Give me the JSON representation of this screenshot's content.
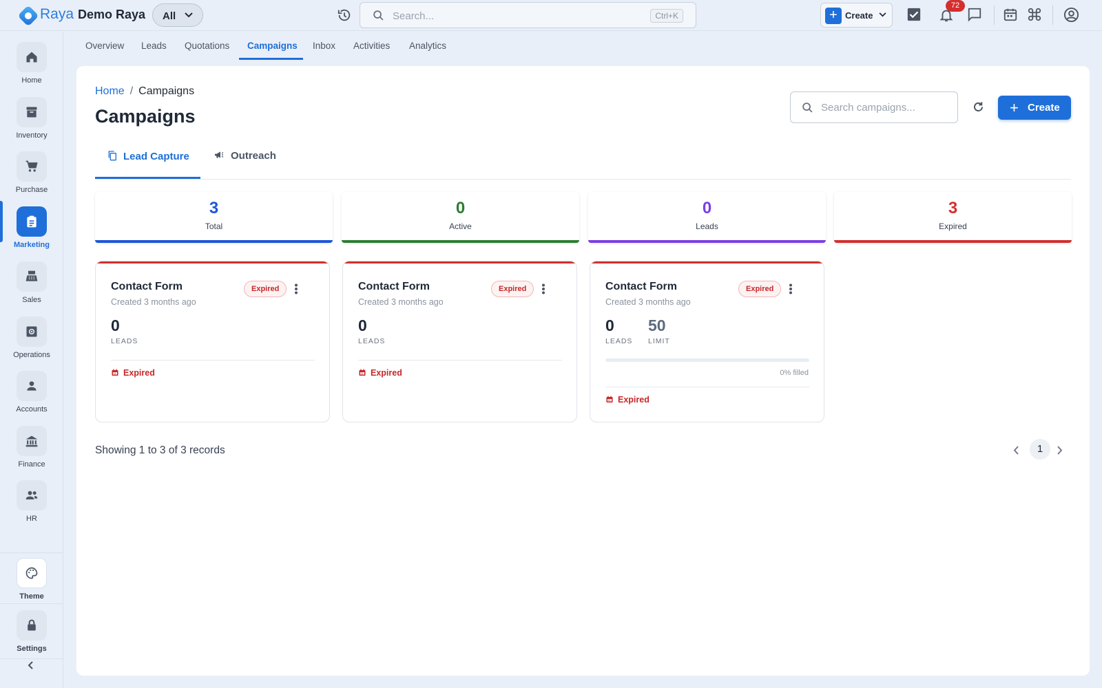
{
  "app": {
    "brand": "Raya",
    "org": "Demo Raya",
    "scope": "All",
    "search_placeholder": "Search...",
    "search_shortcut": "Ctrl+K",
    "create_label": "Create",
    "notification_count": "72"
  },
  "sidebar": {
    "items": [
      {
        "label": "Home",
        "icon": "home-icon"
      },
      {
        "label": "Inventory",
        "icon": "archive-icon"
      },
      {
        "label": "Purchase",
        "icon": "cart-icon"
      },
      {
        "label": "Marketing",
        "icon": "clipboard-icon",
        "active": true
      },
      {
        "label": "Sales",
        "icon": "register-icon"
      },
      {
        "label": "Operations",
        "icon": "cog-box-icon"
      },
      {
        "label": "Accounts",
        "icon": "person-icon"
      },
      {
        "label": "Finance",
        "icon": "bank-icon"
      },
      {
        "label": "HR",
        "icon": "people-icon"
      }
    ],
    "theme_label": "Theme",
    "settings_label": "Settings"
  },
  "subnav": {
    "tabs": [
      "Overview",
      "Leads",
      "Quotations",
      "Campaigns",
      "Inbox",
      "Activities",
      "Analytics"
    ],
    "active": "Campaigns"
  },
  "page": {
    "breadcrumb_home": "Home",
    "breadcrumb_separator": "/",
    "breadcrumb_current": "Campaigns",
    "title": "Campaigns",
    "search_placeholder": "Search campaigns...",
    "create_label": "Create"
  },
  "campaign_tabs": [
    "Lead Capture",
    "Outreach"
  ],
  "stats": [
    {
      "value": "3",
      "label": "Total",
      "color": "#1e56d9"
    },
    {
      "value": "0",
      "label": "Active",
      "color": "#2e7d32"
    },
    {
      "value": "0",
      "label": "Leads",
      "color": "#7b3fe4"
    },
    {
      "value": "3",
      "label": "Expired",
      "color": "#d32f2f"
    }
  ],
  "campaigns": [
    {
      "title": "Contact Form",
      "created": "Created 3 months ago",
      "badge": "Expired",
      "leads": "0",
      "leads_label": "LEADS",
      "status": "Expired"
    },
    {
      "title": "Contact Form",
      "created": "Created 3 months ago",
      "badge": "Expired",
      "leads": "0",
      "leads_label": "LEADS",
      "status": "Expired"
    },
    {
      "title": "Contact Form",
      "created": "Created 3 months ago",
      "badge": "Expired",
      "leads": "0",
      "leads_label": "LEADS",
      "limit": "50",
      "limit_label": "LIMIT",
      "filled_fraction": 0,
      "filled_label": "0% filled",
      "status": "Expired"
    }
  ],
  "footer": {
    "records": "Showing 1 to 3 of 3 records",
    "current_page": "1"
  }
}
